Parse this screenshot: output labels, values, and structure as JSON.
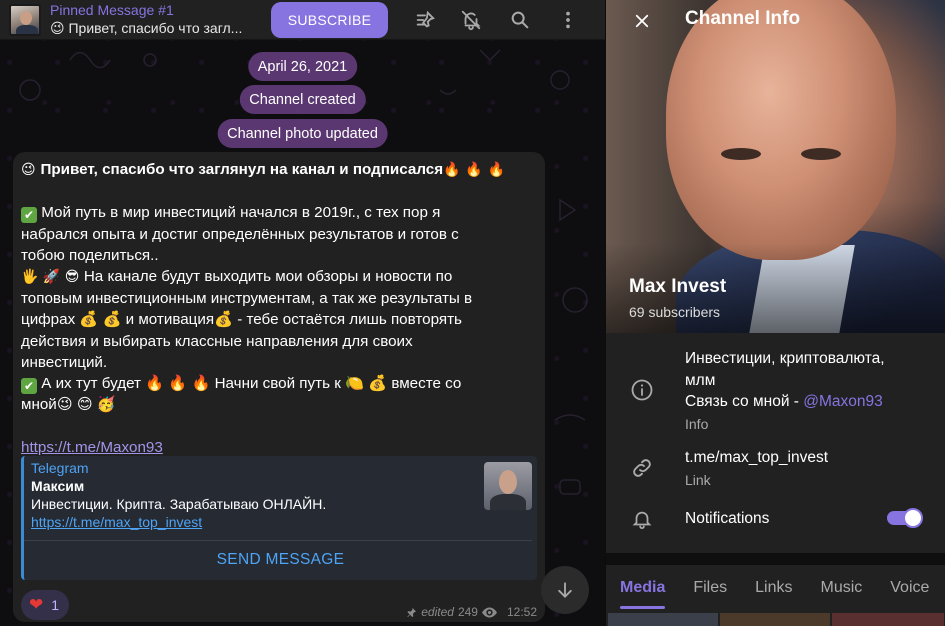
{
  "colors": {
    "accent": "#8774e1",
    "link_blue": "#4ea4f5",
    "bubble_bg": "#212121",
    "service_pill": "#674082",
    "reaction_heart": "#e53935",
    "check_green": "#5fa542"
  },
  "pinned": {
    "title": "Pinned Message #1",
    "preview": "😉 Привет, спасибо что загл..."
  },
  "header": {
    "subscribe_label": "SUBSCRIBE",
    "icons": [
      "pinned-list-icon",
      "mute-icon",
      "search-icon",
      "more-vertical-icon"
    ]
  },
  "service_messages": {
    "date": "April 26, 2021",
    "created": "Channel created",
    "photo_updated": "Channel photo updated"
  },
  "message": {
    "lines": [
      {
        "emoji_pre": "😉 ",
        "text": "Привет, спасибо что заглянул на канал и подписался",
        "emoji_post": "🔥 🔥 🔥",
        "bold": true
      },
      {
        "text": ""
      },
      {
        "check": "✔",
        "text": "  Мой путь в мир инвестиций начался в 2019г., с тех пор я"
      },
      {
        "text": "набрался опыта и достиг определённых результатов и готов с"
      },
      {
        "text": "тобою поделиться.."
      },
      {
        "emoji_pre": "🖐 🚀 😎 ",
        "text": "На канале будут выходить мои обзоры и новости по"
      },
      {
        "text": "топовым инвестиционным инструментам, а так же результаты в"
      },
      {
        "text": "цифрах 💰 💰 и мотивация💰 - тебе остаётся лишь повторять"
      },
      {
        "text": "действия и выбирать классные направления для своих"
      },
      {
        "text": "инвестиций."
      },
      {
        "check": "✔",
        "text": "  А их тут будет 🔥 🔥 🔥  Начни свой путь к 🍋 💰  вместе со"
      },
      {
        "text": "мной😉 😊 🥳"
      },
      {
        "text": ""
      }
    ],
    "link": "https://t.me/Maxon93",
    "preview": {
      "site": "Telegram",
      "title": "Максим",
      "description": "Инвестиции. Крипта. Зарабатываю ОНЛАЙН.",
      "link": "https://t.me/max_top_invest",
      "button": "SEND MESSAGE"
    },
    "reaction": {
      "emoji": "❤",
      "count": "1"
    },
    "edited": "edited",
    "views": "249",
    "time": "12:52"
  },
  "info_panel": {
    "title": "Channel Info",
    "channel_name": "Max Invest",
    "subscribers": "69 subscribers",
    "description_lines": [
      "Инвестиции, криптовалюта,",
      "млм"
    ],
    "contact_prefix": "Связь со мной - ",
    "contact_handle": "@Maxon93",
    "description_label": "Info",
    "link": "t.me/max_top_invest",
    "link_label": "Link",
    "notifications_label": "Notifications",
    "notifications_on": true,
    "tabs": [
      "Media",
      "Files",
      "Links",
      "Music",
      "Voice"
    ],
    "active_tab": "Media"
  }
}
